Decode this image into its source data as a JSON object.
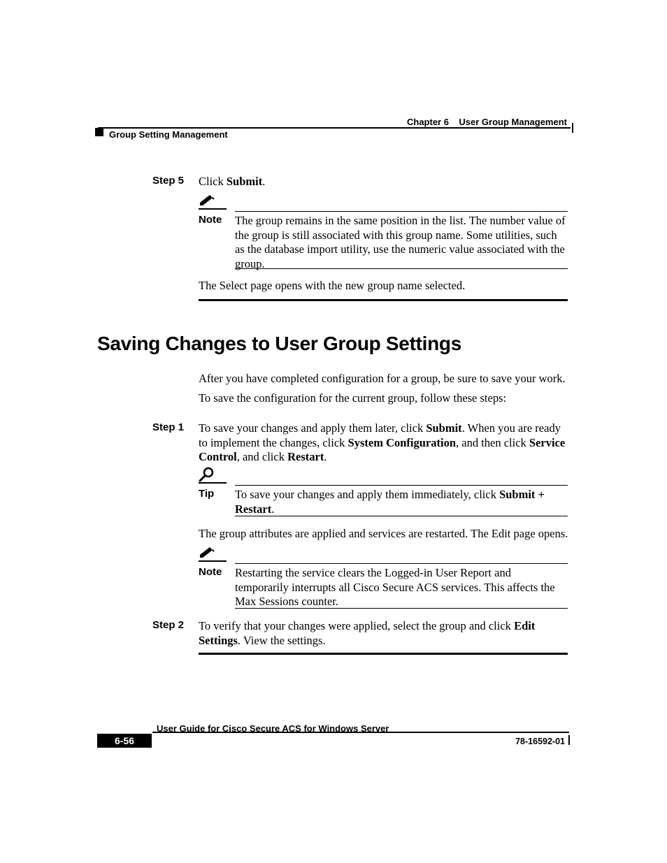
{
  "header": {
    "chapter_label": "Chapter 6",
    "chapter_title": "User Group Management",
    "section": "Group Setting Management"
  },
  "step5": {
    "label": "Step 5",
    "text_pre": "Click ",
    "text_bold": "Submit",
    "text_post": "."
  },
  "note1": {
    "label": "Note",
    "text": "The group remains in the same position in the list. The number value of the group is still associated with this group name. Some utilities, such as the database import utility, use the numeric value associated with the group."
  },
  "after_note1": "The Select page opens with the new group name selected.",
  "heading": "Saving Changes to User Group Settings",
  "intro1": "After you have completed configuration for a group, be sure to save your work.",
  "intro2": "To save the configuration for the current group, follow these steps:",
  "step1": {
    "label": "Step 1",
    "seg1": "To save your changes and apply them later, click ",
    "b1": "Submit",
    "seg2": ". When you are ready to implement the changes, click ",
    "b2": "System Configuration",
    "seg3": ", and then click ",
    "b3": "Service Control",
    "seg4": ", and click ",
    "b4": "Restart",
    "seg5": "."
  },
  "tip": {
    "label": "Tip",
    "seg1": "To save your changes and apply them immediately, click ",
    "b1": "Submit + Restart",
    "seg2": "."
  },
  "after_tip": "The group attributes are applied and services are restarted. The Edit page opens.",
  "note2": {
    "label": "Note",
    "text": "Restarting the service clears the Logged-in User Report and temporarily interrupts all Cisco Secure ACS services. This affects the Max Sessions counter."
  },
  "step2": {
    "label": "Step 2",
    "seg1": "To verify that your changes were applied, select the group and click ",
    "b1": "Edit Settings",
    "seg2": ". View the settings."
  },
  "footer": {
    "guide": "User Guide for Cisco Secure ACS for Windows Server",
    "page": "6-56",
    "docnum": "78-16592-01"
  }
}
